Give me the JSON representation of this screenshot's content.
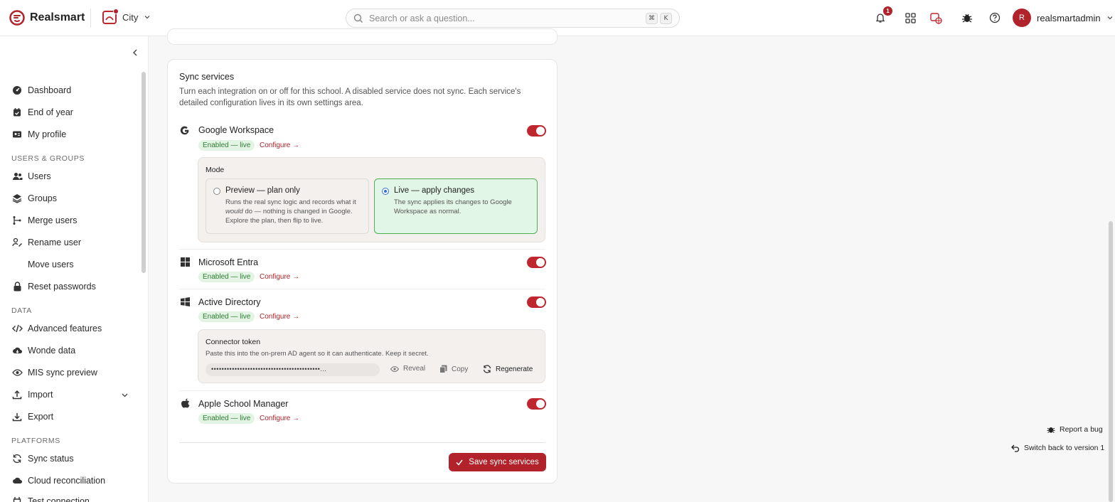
{
  "app": {
    "name": "Realsmart"
  },
  "school": {
    "name": "City"
  },
  "search": {
    "placeholder": "Search or ask a question...",
    "shortcut_key1": "⌘",
    "shortcut_key2": "K"
  },
  "notifications": {
    "count": "1"
  },
  "user": {
    "initial": "R",
    "name": "realsmartadmin"
  },
  "sidebar": {
    "items": [
      {
        "label": "Dashboard",
        "icon": "dashboard-icon"
      },
      {
        "label": "End of year",
        "icon": "calendar-check-icon"
      },
      {
        "label": "My profile",
        "icon": "id-card-icon"
      }
    ],
    "section_users": "USERS & GROUPS",
    "users_items": [
      {
        "label": "Users",
        "icon": "users-icon"
      },
      {
        "label": "Groups",
        "icon": "layers-icon"
      },
      {
        "label": "Merge users",
        "icon": "merge-icon"
      },
      {
        "label": "Rename user",
        "icon": "user-pen-icon"
      },
      {
        "label": "Move users",
        "icon": ""
      },
      {
        "label": "Reset passwords",
        "icon": "lock-icon"
      }
    ],
    "section_data": "DATA",
    "data_items": [
      {
        "label": "Advanced features",
        "icon": "code-icon"
      },
      {
        "label": "Wonde data",
        "icon": "cloud-download-icon"
      },
      {
        "label": "MIS sync preview",
        "icon": "eye-icon"
      },
      {
        "label": "Import",
        "icon": "upload-icon"
      },
      {
        "label": "Export",
        "icon": "download-icon"
      }
    ],
    "section_platforms": "PLATFORMS",
    "platform_items": [
      {
        "label": "Sync status",
        "icon": "sync-icon"
      },
      {
        "label": "Cloud reconciliation",
        "icon": "cloud-icon"
      },
      {
        "label": "Test connection",
        "icon": "plug-icon"
      }
    ]
  },
  "sync": {
    "title": "Sync services",
    "description": "Turn each integration on or off for this school. A disabled service does not sync. Each service's detailed configuration lives in its own settings area.",
    "status_label": "Enabled — live",
    "configure_label": "Configure →",
    "services": [
      {
        "name": "Google Workspace",
        "enabled": true
      },
      {
        "name": "Microsoft Entra",
        "enabled": true
      },
      {
        "name": "Active Directory",
        "enabled": true
      },
      {
        "name": "Apple School Manager",
        "enabled": true
      }
    ],
    "mode": {
      "label": "Mode",
      "preview_title": "Preview — plan only",
      "preview_desc_a": "Runs the real sync logic and records what it",
      "preview_desc_em": "would",
      "preview_desc_b": "do — nothing is changed in Google. Explore the plan, then flip to live.",
      "live_title": "Live — apply changes",
      "live_desc": "The sync applies its changes to Google Workspace as normal.",
      "selected": "live"
    },
    "token": {
      "title": "Connector token",
      "desc": "Paste this into the on-prem AD agent so it can authenticate. Keep it secret.",
      "masked": "••••••••••••••••••••••••••••••••••••••••••...",
      "reveal_label": "Reveal",
      "copy_label": "Copy",
      "regenerate_label": "Regenerate"
    },
    "save_label": "Save sync services"
  },
  "floating": {
    "report_bug": "Report a bug",
    "switch_version": "Switch back to version 1"
  },
  "colors": {
    "accent": "#b1222a",
    "success_bg": "#e3f4e5",
    "success_text": "#2e7d32"
  }
}
